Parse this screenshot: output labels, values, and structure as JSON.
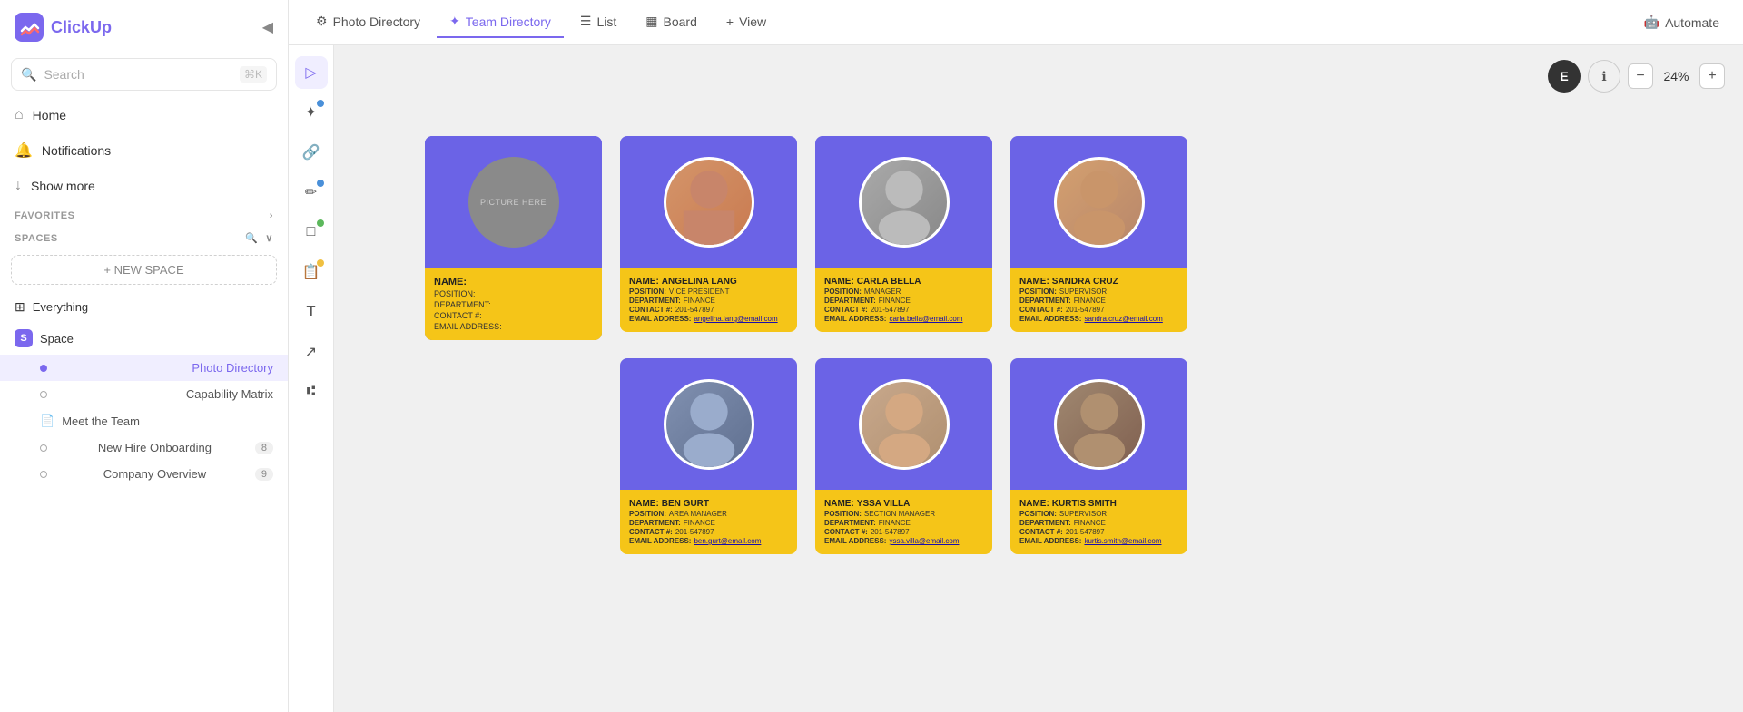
{
  "sidebar": {
    "logo_text": "ClickUp",
    "collapse_icon": "◀",
    "search_placeholder": "Search",
    "search_shortcut": "⌘K",
    "nav_items": [
      {
        "id": "home",
        "icon": "⌂",
        "label": "Home"
      },
      {
        "id": "notifications",
        "icon": "🔔",
        "label": "Notifications"
      },
      {
        "id": "show-more",
        "icon": "↓",
        "label": "Show more"
      }
    ],
    "favorites_label": "FAVORITES",
    "spaces_label": "SPACES",
    "new_space_label": "+ NEW SPACE",
    "spaces": [
      {
        "id": "everything",
        "icon": "⊞",
        "label": "Everything",
        "indent": false
      },
      {
        "id": "space",
        "badge": "S",
        "label": "Space",
        "indent": false
      }
    ],
    "sub_items": [
      {
        "id": "photo-directory",
        "label": "Photo Directory",
        "active": true,
        "doc": false
      },
      {
        "id": "capability-matrix",
        "label": "Capability Matrix",
        "active": false,
        "doc": false
      },
      {
        "id": "meet-the-team",
        "label": "Meet the Team",
        "active": false,
        "doc": true
      },
      {
        "id": "new-hire-onboarding",
        "label": "New Hire Onboarding",
        "active": false,
        "doc": false,
        "count": "8"
      },
      {
        "id": "company-overview",
        "label": "Company Overview",
        "active": false,
        "doc": false,
        "count": "9"
      }
    ]
  },
  "tabs": {
    "items": [
      {
        "id": "photo-directory",
        "icon": "⚙",
        "label": "Photo Directory",
        "active": false
      },
      {
        "id": "team-directory",
        "icon": "✦",
        "label": "Team Directory",
        "active": true
      },
      {
        "id": "list",
        "icon": "☰",
        "label": "List",
        "active": false
      },
      {
        "id": "board",
        "icon": "▦",
        "label": "Board",
        "active": false
      },
      {
        "id": "view",
        "icon": "+",
        "label": "View",
        "active": false
      }
    ],
    "automate_label": "Automate"
  },
  "zoom": {
    "avatar_letter": "E",
    "level": "24%"
  },
  "toolbar": {
    "tools": [
      {
        "id": "cursor",
        "icon": "▷",
        "active": true,
        "dot": null
      },
      {
        "id": "add",
        "icon": "✦+",
        "active": false,
        "dot": "blue"
      },
      {
        "id": "link",
        "icon": "🔗",
        "active": false,
        "dot": null
      },
      {
        "id": "pencil",
        "icon": "✏",
        "active": false,
        "dot": "blue"
      },
      {
        "id": "shape",
        "icon": "□",
        "active": false,
        "dot": "green"
      },
      {
        "id": "note",
        "icon": "📋",
        "active": false,
        "dot": "yellow"
      },
      {
        "id": "text",
        "icon": "T",
        "active": false,
        "dot": null
      },
      {
        "id": "arrow",
        "icon": "↗",
        "active": false,
        "dot": null
      },
      {
        "id": "connect",
        "icon": "⑆",
        "active": false,
        "dot": null
      }
    ]
  },
  "template_card": {
    "picture_text": "PICTURE HERE",
    "name_label": "NAME:",
    "fields": [
      "POSITION:",
      "DEPARTMENT:",
      "CONTACT #:",
      "EMAIL ADDRESS:"
    ]
  },
  "people": [
    {
      "id": "angelina-lang",
      "name": "ANGELINA LANG",
      "position": "VICE PRESIDENT",
      "department": "FINANCE",
      "contact": "201-547897",
      "email": "angelina.lang@email.com",
      "photo_bg": "#b0b0b0"
    },
    {
      "id": "carla-bella",
      "name": "CARLA BELLA",
      "position": "MANAGER",
      "department": "FINANCE",
      "contact": "201-547897",
      "email": "carla.bella@email.com",
      "photo_bg": "#c0c0c0"
    },
    {
      "id": "sandra-cruz",
      "name": "SANDRA CRUZ",
      "position": "SUPERVISOR",
      "department": "FINANCE",
      "contact": "201-547897",
      "email": "sandra.cruz@email.com",
      "photo_bg": "#a0a0b0"
    },
    {
      "id": "ben-gurt",
      "name": "BEN GURT",
      "position": "AREA MANAGER",
      "department": "FINANCE",
      "contact": "201-547897",
      "email": "ben.gurt@email.com",
      "photo_bg": "#9090b0"
    },
    {
      "id": "yssa-villa",
      "name": "YSSA VILLA",
      "position": "SECTION MANAGER",
      "department": "FINANCE",
      "contact": "201-547897",
      "email": "yssa.villa@email.com",
      "photo_bg": "#b0a090"
    },
    {
      "id": "kurtis-smith",
      "name": "KURTIS SMITH",
      "position": "SUPERVISOR",
      "department": "FINANCE",
      "contact": "201-547897",
      "email": "kurtis.smith@email.com",
      "photo_bg": "#909090"
    }
  ]
}
